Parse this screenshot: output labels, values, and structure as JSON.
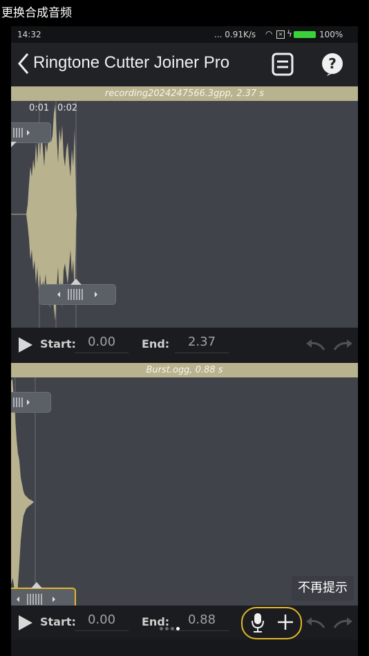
{
  "caption": "更换合成音频",
  "status": {
    "time": "14:32",
    "net": "... 0.91K/s",
    "battery": "100%"
  },
  "appbar": {
    "title": "Ringtone Cutter Joiner Pro"
  },
  "track1": {
    "filename": "recording2024247566.3gpp, 2.37 s",
    "ticks": [
      "0:01",
      "0:02"
    ],
    "start_label": "Start:",
    "start_value": "0.00",
    "end_label": "End:",
    "end_value": "2.37"
  },
  "track2": {
    "filename": "Burst.ogg, 0.88 s",
    "start_label": "Start:",
    "start_value": "0.00",
    "end_label": "End:",
    "end_value": "0.88"
  },
  "tooltip": "不再提示",
  "page_indicator": {
    "count": 4,
    "active": 4
  },
  "colors": {
    "waveform": "#b9b28f",
    "highlight": "#e5b82a",
    "track_bg": "#41434b"
  }
}
